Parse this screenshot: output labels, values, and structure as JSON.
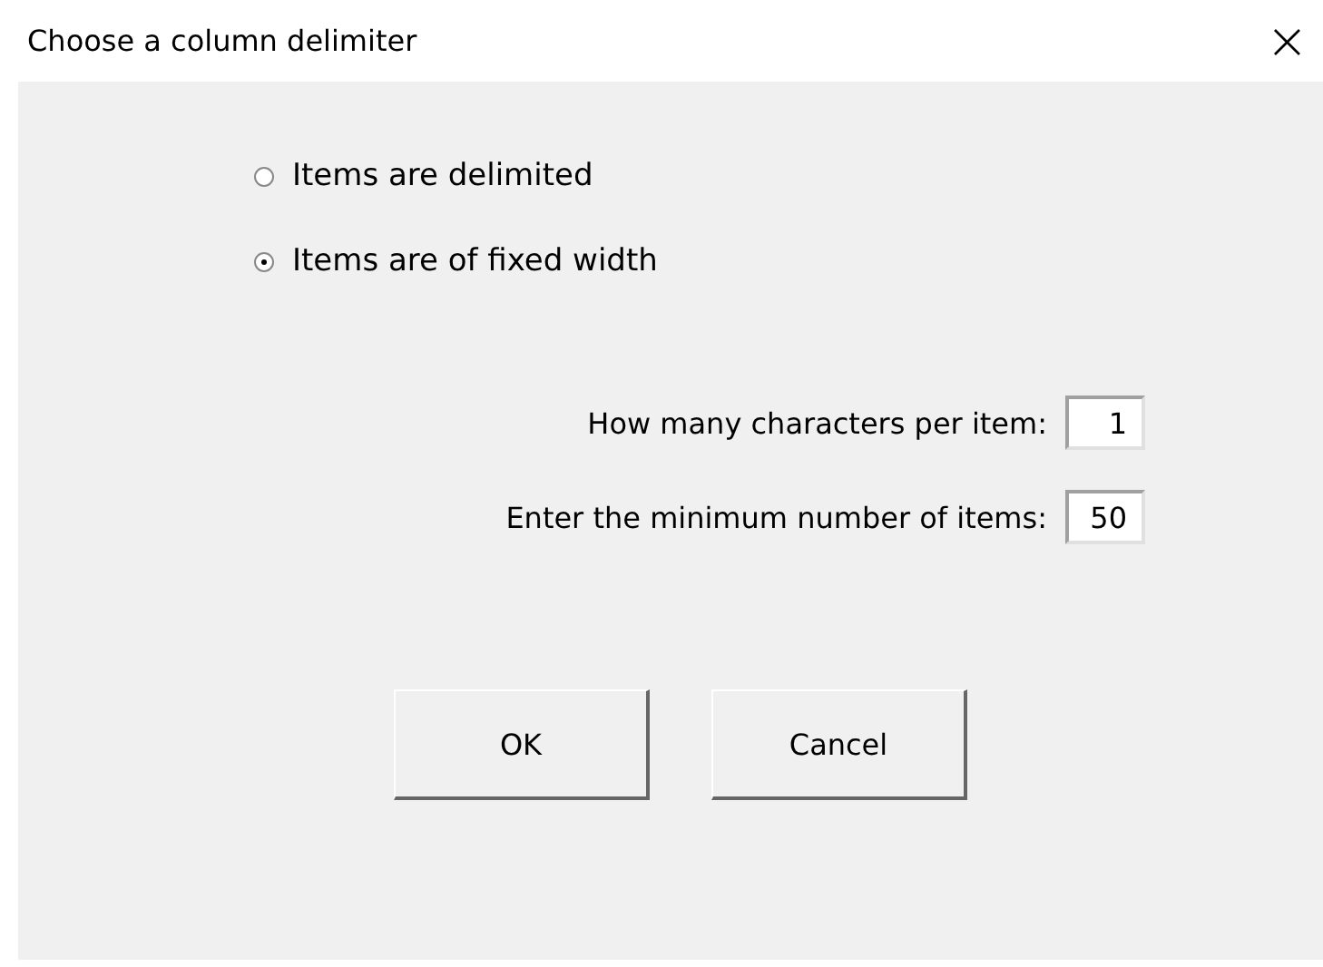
{
  "window": {
    "title": "Choose a column delimiter",
    "close": "×"
  },
  "options": [
    {
      "label": "Items are delimited",
      "selected": false
    },
    {
      "label": "Items are of fixed width",
      "selected": true
    }
  ],
  "fields": [
    {
      "label": "How many characters per item:",
      "value": "1"
    },
    {
      "label": "Enter the minimum number of items:",
      "value": "50"
    }
  ],
  "buttons": [
    "OK",
    "Cancel"
  ]
}
